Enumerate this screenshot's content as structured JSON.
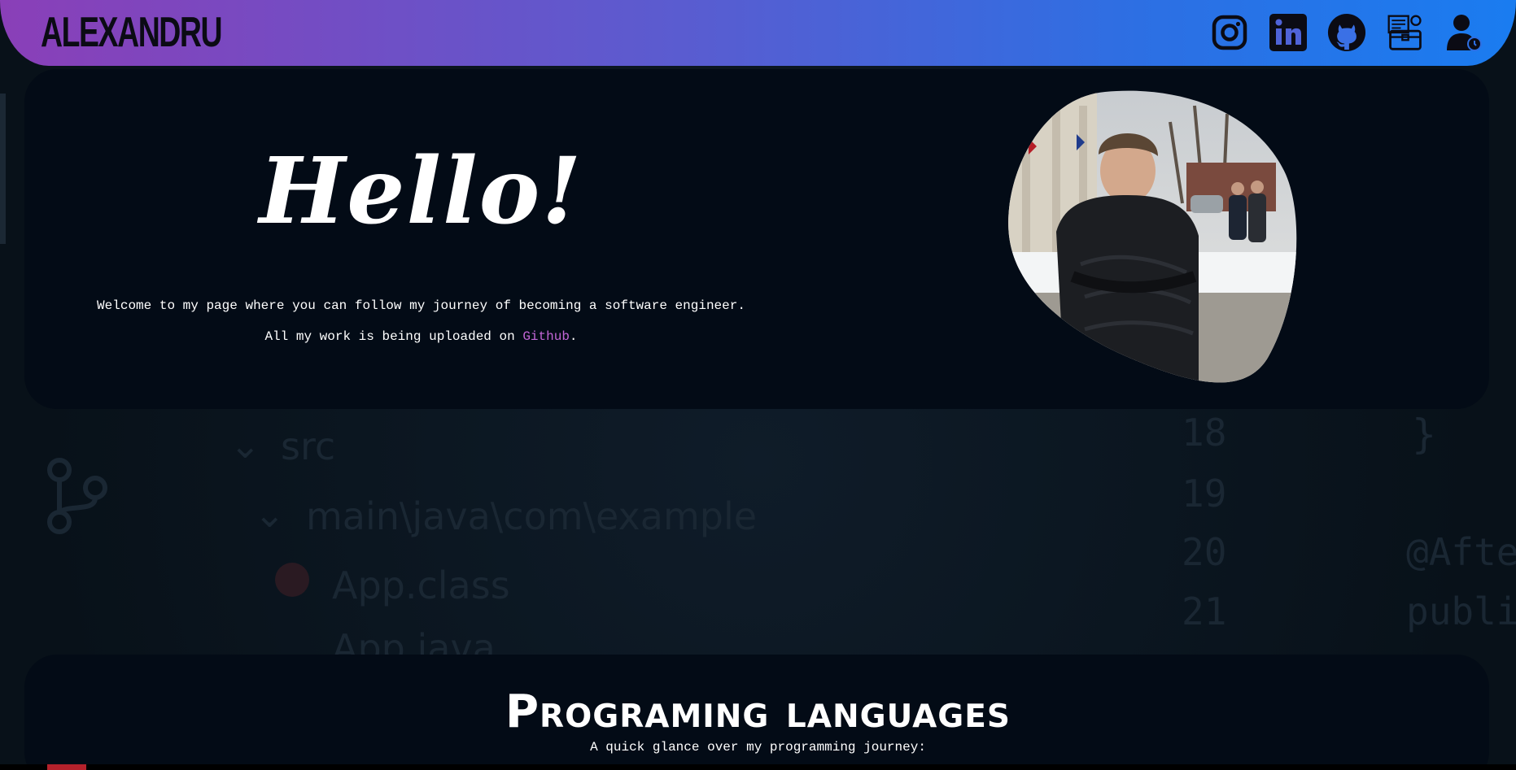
{
  "header": {
    "brand": "ALEXANDRU",
    "icons": [
      {
        "name": "instagram-icon"
      },
      {
        "name": "linkedin-icon"
      },
      {
        "name": "github-icon"
      },
      {
        "name": "portfolio-icon"
      },
      {
        "name": "profile-icon"
      }
    ]
  },
  "hero": {
    "greeting": "Hello!",
    "welcome_text": "Welcome to my page where you can follow my journey of becoming a software engineer.",
    "upload_prefix": "All my work is being uploaded on ",
    "upload_link": "Github",
    "upload_suffix": "."
  },
  "background_code": {
    "folder_src": "src",
    "folder_path": "main\\java\\com\\example",
    "file1": "App.class",
    "file2": "App.java",
    "line_numbers": [
      "18",
      "19",
      "20",
      "21"
    ],
    "brace": "}",
    "annotation": "@Afte",
    "keyword": "publi"
  },
  "languages": {
    "title": "Programing languages",
    "subtitle": "A quick glance over my programming journey:"
  },
  "colors": {
    "accent_link": "#c266d6",
    "header_gradient_start": "#8a3fb8",
    "header_gradient_end": "#1a7cf0",
    "card_bg": "#030b16"
  }
}
